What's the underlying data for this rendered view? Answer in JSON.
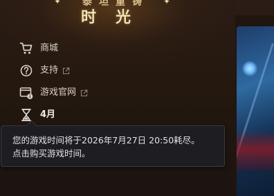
{
  "logo": {
    "top_text": "泰坦重铸",
    "main_text": "时光",
    "star_glyph": "✦"
  },
  "menu": {
    "items": [
      {
        "label": "商城",
        "icon": "cart-icon",
        "external": false
      },
      {
        "label": "支持",
        "icon": "help-circle-icon",
        "external": true
      },
      {
        "label": "游戏官网",
        "icon": "web-window-icon",
        "external": true
      },
      {
        "label": "4月",
        "icon": "hourglass-icon",
        "external": false
      }
    ]
  },
  "tooltip": {
    "line1": "您的游戏时间将于2026年7月27日 20:50耗尽。",
    "line2": "点击购买游戏时间。"
  },
  "colors": {
    "menu_text": "#d9d2c8",
    "tooltip_bg": "#1d1d22",
    "logo_gold": "#f1e2b6"
  }
}
